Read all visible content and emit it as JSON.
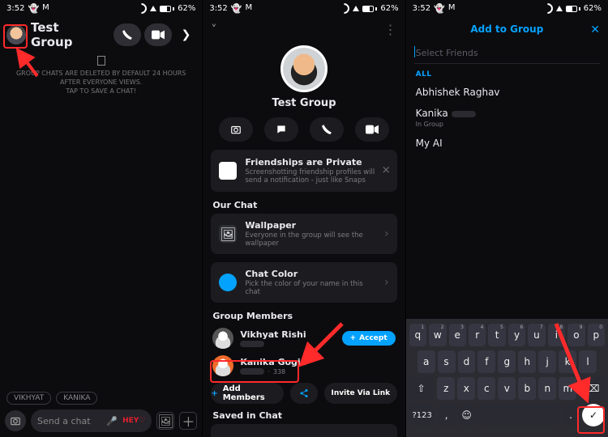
{
  "status": {
    "time": "3:52",
    "battery_pct": "62%"
  },
  "panel1": {
    "title": "Test Group",
    "info_line1": "GROUP CHATS ARE DELETED BY DEFAULT 24 HOURS AFTER EVERYONE VIEWS.",
    "info_line2": "TAP TO SAVE A CHAT!",
    "chips": [
      "VIKHYAT",
      "KANIKA"
    ],
    "composer": {
      "placeholder": "Send a chat",
      "sticker": "HEY♡"
    }
  },
  "panel2": {
    "group_name": "Test Group",
    "friendship": {
      "title": "Friendships are Private",
      "sub": "Screenshotting friendship profiles will send a notification - just like Snaps"
    },
    "our_chat_label": "Our Chat",
    "wallpaper": {
      "title": "Wallpaper",
      "sub": "Everyone in the group will see the wallpaper"
    },
    "chat_color": {
      "title": "Chat Color",
      "sub": "Pick the color of your name in this chat"
    },
    "group_members_label": "Group Members",
    "members": [
      {
        "name": "Vikhyat Rishi",
        "accept": true
      },
      {
        "name": "Kanika Gogia",
        "score": "338"
      }
    ],
    "accept_label": "Accept",
    "add_members_label": "Add Members",
    "invite_label": "Invite Via Link",
    "saved_label": "Saved in Chat"
  },
  "panel3": {
    "title": "Add to Group",
    "search_placeholder": "Select Friends",
    "all_label": "ALL",
    "friends": [
      {
        "name": "Abhishek Raghav"
      },
      {
        "name": "Kanika",
        "sub": "In Group",
        "obscure": true
      },
      {
        "name": "My AI"
      }
    ]
  },
  "keyboard": {
    "row1": [
      [
        "q",
        "1"
      ],
      [
        "w",
        "2"
      ],
      [
        "e",
        "3"
      ],
      [
        "r",
        "4"
      ],
      [
        "t",
        "5"
      ],
      [
        "y",
        "6"
      ],
      [
        "u",
        "7"
      ],
      [
        "i",
        "8"
      ],
      [
        "o",
        "9"
      ],
      [
        "p",
        "0"
      ]
    ],
    "row2": [
      "a",
      "s",
      "d",
      "f",
      "g",
      "h",
      "j",
      "k",
      "l"
    ],
    "row3": [
      "z",
      "x",
      "c",
      "v",
      "b",
      "n",
      "m"
    ],
    "q123": "?123"
  }
}
